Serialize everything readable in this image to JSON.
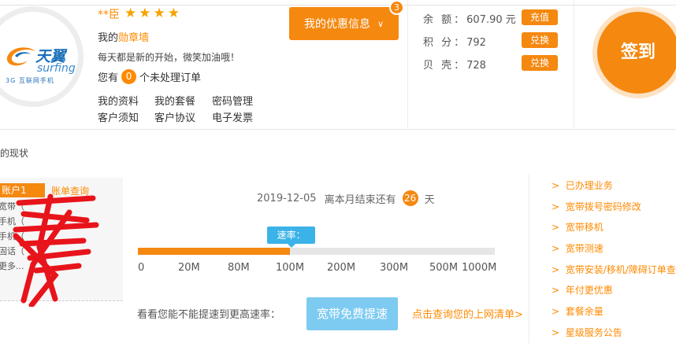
{
  "profile": {
    "logo_cn": "天翼",
    "logo_en": "surfing",
    "logo_sub": "3G 互联网手机",
    "username": "**臣",
    "stars": "★★★★",
    "badge_prefix": "我的",
    "badge_link": "勋章墙",
    "slogan": "每天都是新的开始，微笑加油哦！",
    "orders_prefix": "您有",
    "orders_count": "0",
    "orders_suffix": "个未处理订单",
    "links": [
      "我的资料",
      "我的套餐",
      "密码管理",
      "客户须知",
      "客户协议",
      "电子发票"
    ]
  },
  "promo": {
    "label": "我的优惠信息",
    "count": "3"
  },
  "account": {
    "balance_label": "余 额：",
    "balance_value": "607.90 元",
    "balance_btn": "充值",
    "points_label": "积 分：",
    "points_value": "792",
    "points_btn": "兑换",
    "shells_label": "贝 壳：",
    "shells_value": "728",
    "shells_btn": "兑换"
  },
  "signin": {
    "label": "签到"
  },
  "section": {
    "title": "的现状"
  },
  "accounts": {
    "tab": "账户1",
    "query": "账单查询",
    "items": [
      "宽带（",
      "手机（",
      "手机（",
      "固话（",
      "更多..."
    ]
  },
  "broadband": {
    "date": "2019-12-05",
    "remain_prefix": "离本月结束还有",
    "remain_days": "26",
    "remain_suffix": "天",
    "speed_label": "速率：100M",
    "speed_fraction": 0.425,
    "ticks": [
      "0",
      "20M",
      "80M",
      "100M",
      "200M",
      "300M",
      "500M",
      "1000M"
    ],
    "upgrade_question": "看看您能不能提速到更高速率：",
    "upgrade_button": "宽带免费提速",
    "query_link": "点击查询您的上网清单>"
  },
  "side_links": [
    "已办理业务",
    "宽带拨号密码修改",
    "宽带移机",
    "宽带测速",
    "宽带安装/移机/障碍订单查询",
    "年付更优惠",
    "套餐余量",
    "星级服务公告"
  ],
  "colors": {
    "accent": "#f5880f",
    "link": "#ff8a00",
    "tip": "#3bb3e8",
    "upgrade": "#7ecbf1"
  }
}
